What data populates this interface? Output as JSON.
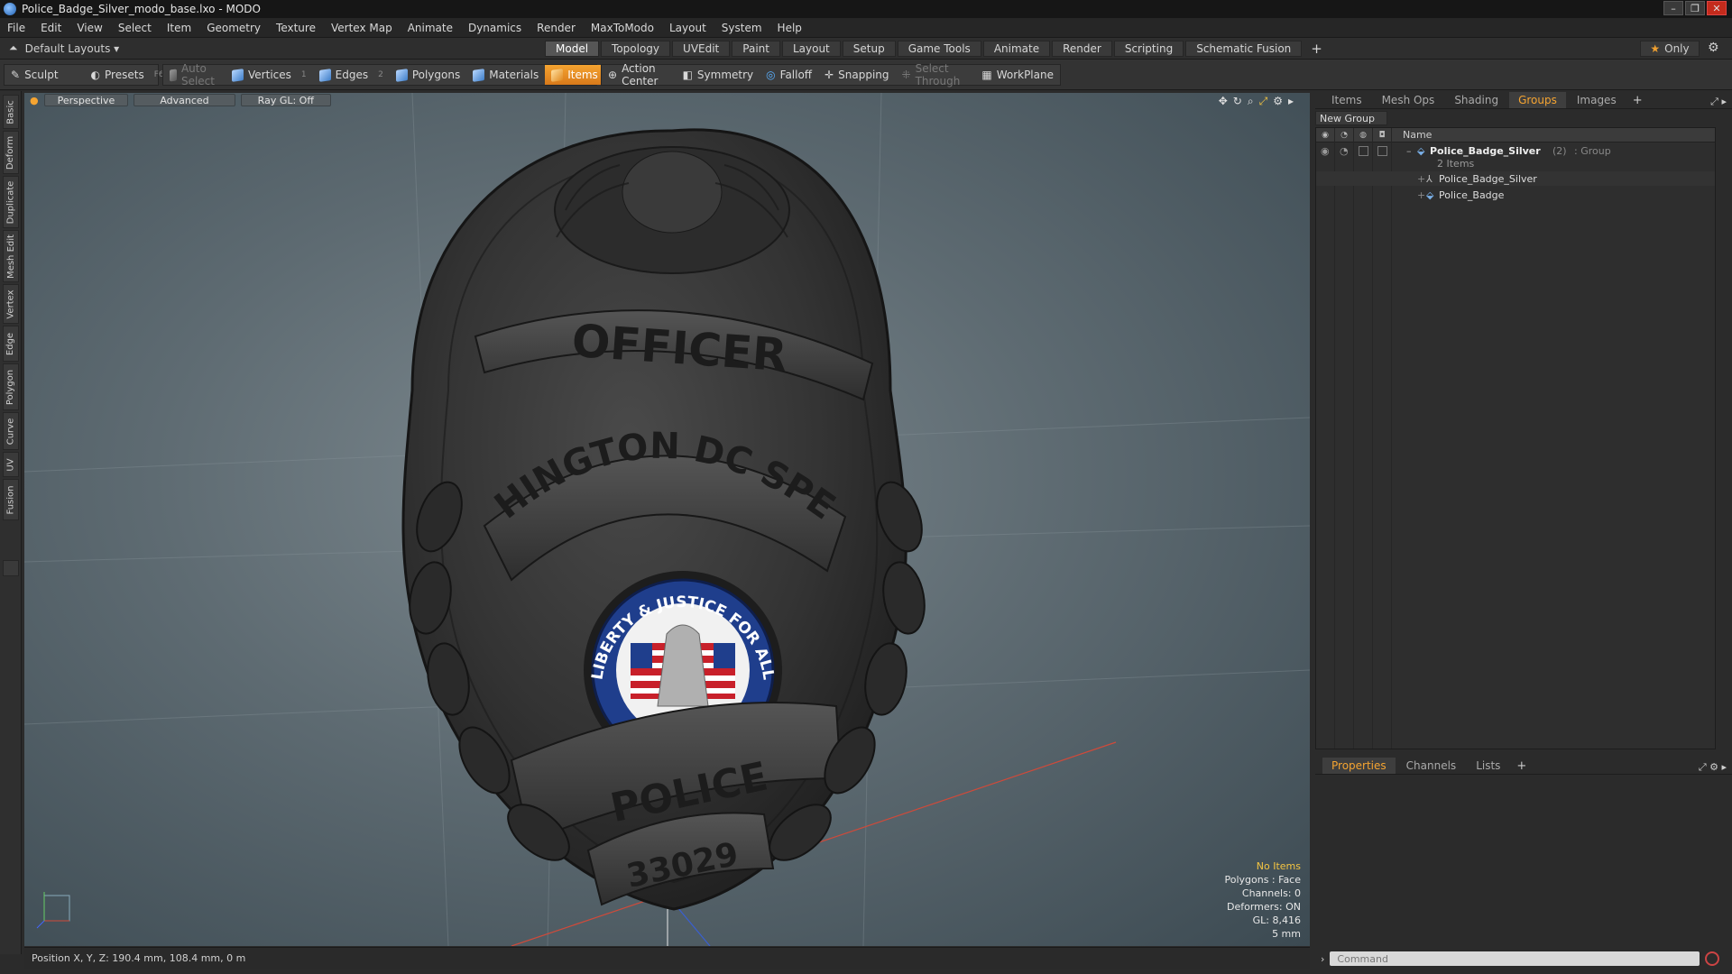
{
  "window": {
    "title": "Police_Badge_Silver_modo_base.lxo - MODO",
    "controls": [
      "–",
      "❐",
      "✕"
    ]
  },
  "menu": [
    "File",
    "Edit",
    "View",
    "Select",
    "Item",
    "Geometry",
    "Texture",
    "Vertex Map",
    "Animate",
    "Dynamics",
    "Render",
    "MaxToModo",
    "Layout",
    "System",
    "Help"
  ],
  "layoutbar": {
    "layout_label": "Default Layouts",
    "tabs": [
      "Model",
      "Topology",
      "UVEdit",
      "Paint",
      "Layout",
      "Setup",
      "Game Tools",
      "Animate",
      "Render",
      "Scripting",
      "Schematic Fusion"
    ],
    "active_tab": "Model",
    "only_label": "Only"
  },
  "toolbar": {
    "sculpt": "Sculpt",
    "presets": "Presets",
    "presets_key": "F6",
    "auto_select": "Auto Select",
    "vertices": "Vertices",
    "vertices_key": "1",
    "edges": "Edges",
    "edges_key": "2",
    "polygons": "Polygons",
    "materials": "Materials",
    "items": "Items",
    "action_center": "Action Center",
    "symmetry": "Symmetry",
    "falloff": "Falloff",
    "snapping": "Snapping",
    "select_through": "Select Through",
    "workplane": "WorkPlane"
  },
  "left_tabs": [
    "Basic",
    "Deform",
    "Duplicate",
    "Mesh Edit",
    "Vertex",
    "Edge",
    "Polygon",
    "Curve",
    "UV",
    "Fusion"
  ],
  "viewport": {
    "view_mode": "Perspective",
    "shading": "Advanced",
    "raygl": "Ray GL: Off",
    "badge_text": {
      "top": "OFFICER",
      "arc": "WASHINGTON DC SPECIAL",
      "bottom": "POLICE",
      "number": "33029",
      "seal_text": "LIBERTY & JUSTICE FOR ALL"
    },
    "info": {
      "selection": "No Items",
      "polygons": "Polygons : Face",
      "channels": "Channels: 0",
      "deformers": "Deformers: ON",
      "gl": "GL: 8,416",
      "grid": "5 mm"
    }
  },
  "statusbar": {
    "position": "Position X, Y, Z:  190.4 mm, 108.4 mm, 0 m"
  },
  "right_panel": {
    "tabs": [
      "Items",
      "Mesh Ops",
      "Shading",
      "Groups",
      "Images"
    ],
    "active_tab": "Groups",
    "new_group": "New Group",
    "column_name": "Name",
    "group": {
      "name": "Police_Badge_Silver",
      "count": "(2)",
      "type": ": Group",
      "sub": "2 Items"
    },
    "children": [
      "Police_Badge_Silver",
      "Police_Badge"
    ],
    "bottom_tabs": [
      "Properties",
      "Channels",
      "Lists"
    ],
    "bottom_active": "Properties",
    "command_placeholder": "Command"
  },
  "colors": {
    "accent": "#f5a431",
    "active_tab": "#f5a431",
    "info_warn": "#f5c542"
  }
}
